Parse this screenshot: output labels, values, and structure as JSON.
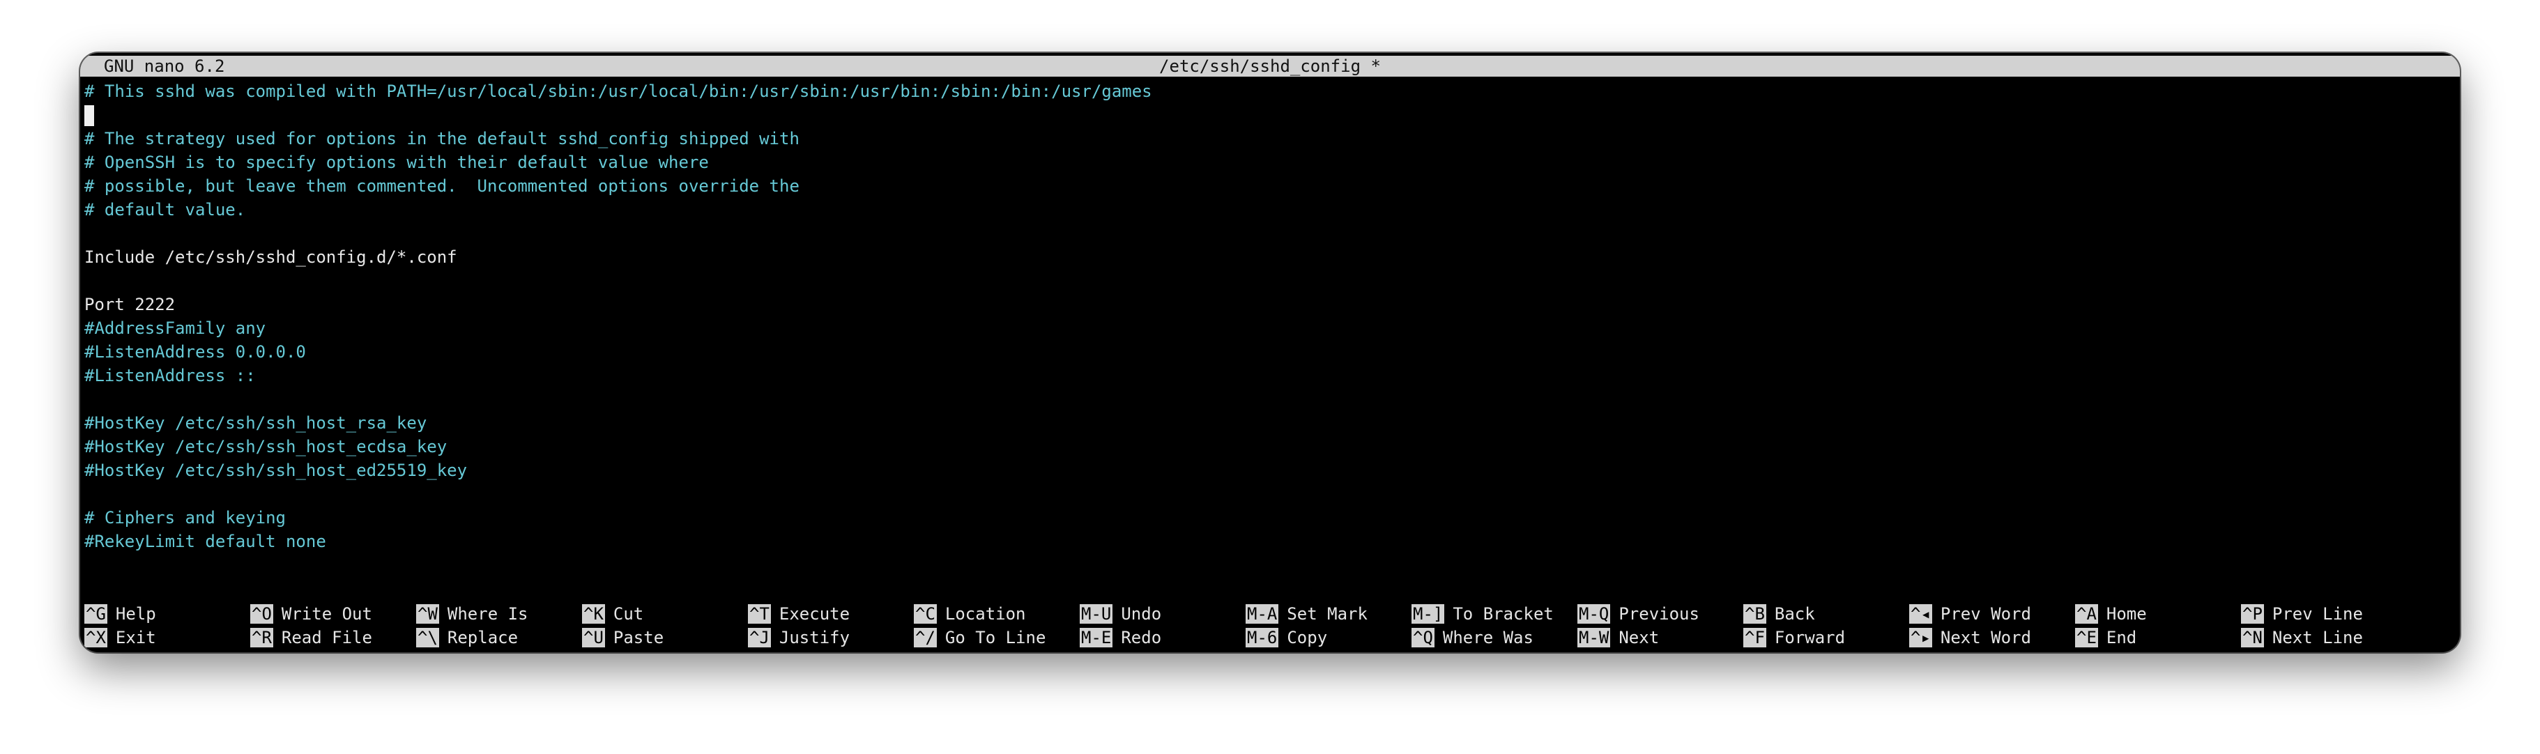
{
  "titlebar": {
    "app": "GNU nano 6.2",
    "file": "/etc/ssh/sshd_config *"
  },
  "editor_lines": [
    {
      "text": "# This sshd was compiled with PATH=/usr/local/sbin:/usr/local/bin:/usr/sbin:/usr/bin:/sbin:/bin:/usr/games",
      "type": "comment"
    },
    {
      "text": "",
      "type": "cursor"
    },
    {
      "text": "# The strategy used for options in the default sshd_config shipped with",
      "type": "comment"
    },
    {
      "text": "# OpenSSH is to specify options with their default value where",
      "type": "comment"
    },
    {
      "text": "# possible, but leave them commented.  Uncommented options override the",
      "type": "comment"
    },
    {
      "text": "# default value.",
      "type": "comment"
    },
    {
      "text": "",
      "type": "blank"
    },
    {
      "text": "Include /etc/ssh/sshd_config.d/*.conf",
      "type": "code"
    },
    {
      "text": "",
      "type": "blank"
    },
    {
      "text": "Port 2222",
      "type": "code"
    },
    {
      "text": "#AddressFamily any",
      "type": "comment"
    },
    {
      "text": "#ListenAddress 0.0.0.0",
      "type": "comment"
    },
    {
      "text": "#ListenAddress ::",
      "type": "comment"
    },
    {
      "text": "",
      "type": "blank"
    },
    {
      "text": "#HostKey /etc/ssh/ssh_host_rsa_key",
      "type": "comment"
    },
    {
      "text": "#HostKey /etc/ssh/ssh_host_ecdsa_key",
      "type": "comment"
    },
    {
      "text": "#HostKey /etc/ssh/ssh_host_ed25519_key",
      "type": "comment"
    },
    {
      "text": "",
      "type": "blank"
    },
    {
      "text": "# Ciphers and keying",
      "type": "comment"
    },
    {
      "text": "#RekeyLimit default none",
      "type": "comment"
    }
  ],
  "shortcuts": [
    [
      {
        "key": "^G",
        "label": "Help"
      },
      {
        "key": "^O",
        "label": "Write Out"
      },
      {
        "key": "^W",
        "label": "Where Is"
      },
      {
        "key": "^K",
        "label": "Cut"
      },
      {
        "key": "^T",
        "label": "Execute"
      },
      {
        "key": "^C",
        "label": "Location"
      },
      {
        "key": "M-U",
        "label": "Undo"
      },
      {
        "key": "M-A",
        "label": "Set Mark"
      },
      {
        "key": "M-]",
        "label": "To Bracket"
      },
      {
        "key": "M-Q",
        "label": "Previous"
      },
      {
        "key": "^B",
        "label": "Back"
      },
      {
        "key": "^◂",
        "label": "Prev Word"
      },
      {
        "key": "^A",
        "label": "Home"
      },
      {
        "key": "^P",
        "label": "Prev Line"
      }
    ],
    [
      {
        "key": "^X",
        "label": "Exit"
      },
      {
        "key": "^R",
        "label": "Read File"
      },
      {
        "key": "^\\",
        "label": "Replace"
      },
      {
        "key": "^U",
        "label": "Paste"
      },
      {
        "key": "^J",
        "label": "Justify"
      },
      {
        "key": "^/",
        "label": "Go To Line"
      },
      {
        "key": "M-E",
        "label": "Redo"
      },
      {
        "key": "M-6",
        "label": "Copy"
      },
      {
        "key": "^Q",
        "label": "Where Was"
      },
      {
        "key": "M-W",
        "label": "Next"
      },
      {
        "key": "^F",
        "label": "Forward"
      },
      {
        "key": "^▸",
        "label": "Next Word"
      },
      {
        "key": "^E",
        "label": "End"
      },
      {
        "key": "^N",
        "label": "Next Line"
      }
    ]
  ]
}
